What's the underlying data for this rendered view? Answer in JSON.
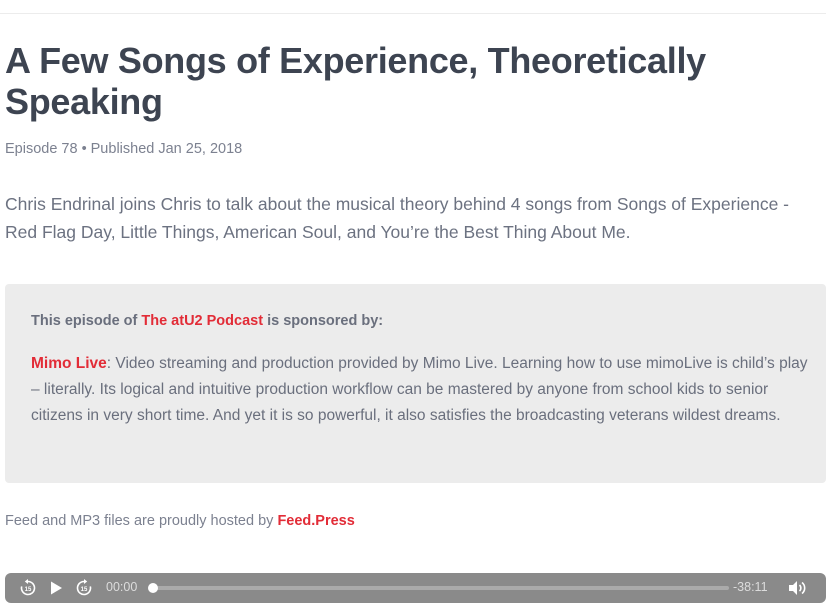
{
  "episode": {
    "title": "A Few Songs of Experience, Theoretically Speaking",
    "number_label": "Episode 78",
    "separator": "•",
    "published": "Published Jan 25, 2018",
    "summary": "Chris Endrinal joins Chris to talk about the musical theory behind 4 songs from Songs of Experience - Red Flag Day, Little Things, American Soul, and You’re the Best Thing About Me."
  },
  "sponsor": {
    "heading_prefix": "This episode of ",
    "podcast_link": "The atU2 Podcast",
    "heading_suffix": " is sponsored by:",
    "name_link": "Mimo Live",
    "description": ": Video streaming and production provided by Mimo Live. Learning how to use mimoLive is child’s play – literally. Its logical and intuitive production workflow can be mastered by anyone from school kids to senior citizens in very short time. And yet it is so powerful, it also satisfies the broadcasting veterans wildest dreams."
  },
  "hosting": {
    "text": "Feed and MP3 files are proudly hosted by ",
    "link": "Feed.Press"
  },
  "player": {
    "current_time": "00:00",
    "remaining_time": "-38:11",
    "progress": 0,
    "rewind_icon": "rewind-15-icon",
    "play_icon": "play-icon",
    "forward_icon": "forward-15-icon",
    "volume_icon": "volume-icon"
  },
  "colors": {
    "accent": "#e22c37",
    "title": "#3d4451",
    "body_text": "#6c7281",
    "sponsor_bg": "#ececec",
    "player_bg": "#8a8a8a"
  }
}
